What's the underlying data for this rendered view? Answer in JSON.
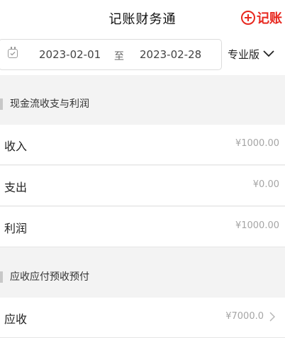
{
  "header": {
    "title": "记账财务通",
    "add_label": "记账"
  },
  "filter": {
    "start_date": "2023-02-01",
    "separator": "至",
    "end_date": "2023-02-28",
    "version": "专业版"
  },
  "sections": {
    "cashflow": {
      "title": "现金流收支与利润",
      "rows": [
        {
          "label": "收入",
          "value": "¥1000.00"
        },
        {
          "label": "支出",
          "value": "¥0.00"
        },
        {
          "label": "利润",
          "value": "¥1000.00"
        }
      ]
    },
    "receivables": {
      "title": "应收应付预收预付",
      "rows": [
        {
          "label": "应收",
          "value": "¥7000.0"
        }
      ]
    }
  },
  "colors": {
    "accent": "#e8281f",
    "background": "#f3f3f3",
    "value_text": "#a5a5a5"
  }
}
